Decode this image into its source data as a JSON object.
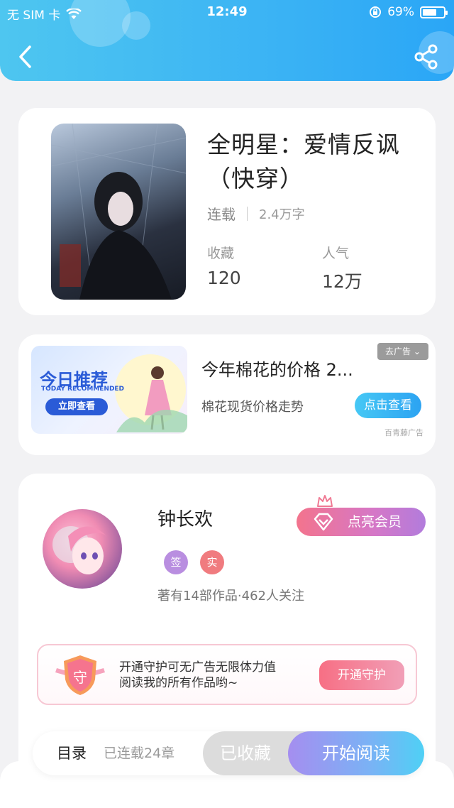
{
  "status_bar": {
    "carrier": "无 SIM 卡",
    "time": "12:49",
    "battery": "69%"
  },
  "book": {
    "title": "全明星：爱情反讽（快穿）",
    "status": "连载",
    "word_count": "2.4万字",
    "favorites_label": "收藏",
    "favorites_value": "120",
    "popularity_label": "人气",
    "popularity_value": "12万"
  },
  "ad": {
    "banner_title": "今日推荐",
    "banner_subtitle": "TODAY RECOMMENDED",
    "banner_button": "立即查看",
    "title": "今年棉花的价格 2...",
    "description": "棉花现货价格走势",
    "cta": "点击查看",
    "close_label": "去广告",
    "source": "百青藤广告"
  },
  "author": {
    "name": "钟长欢",
    "badge_sign": "签",
    "badge_real": "实",
    "stats": "著有14部作品·462人关注",
    "vip_label": "点亮会员",
    "guard_text_line1": "开通守护可无广告无限体力值",
    "guard_text_line2": "阅读我的所有作品哟~",
    "guard_shield_char": "守",
    "guard_button": "开通守护"
  },
  "bottom_bar": {
    "catalog": "目录",
    "chapters": "已连载24章",
    "collected": "已收藏",
    "start_reading": "开始阅读"
  },
  "colors": {
    "header": "#3bb3f4",
    "badge_sign": "#b98ee0",
    "badge_real": "#f07b7f",
    "guard_button": "#f76f84"
  }
}
